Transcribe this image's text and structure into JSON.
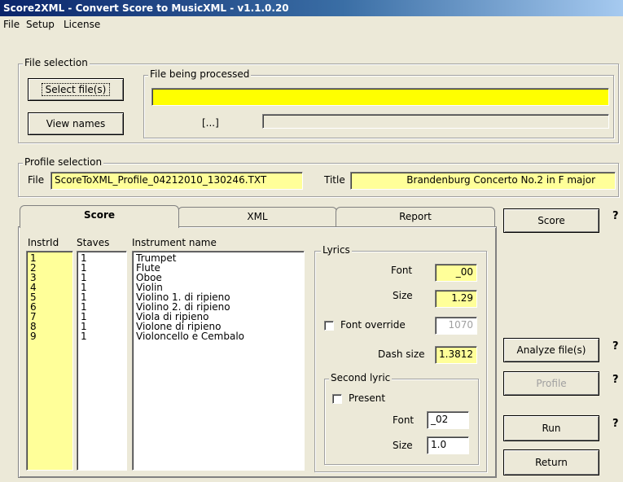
{
  "window": {
    "title": "Score2XML - Convert Score to MusicXML - v1.1.0.20"
  },
  "menu": {
    "file": "File",
    "setup": "Setup",
    "license": "License"
  },
  "file_selection": {
    "group_label": "File selection",
    "select_button": "Select file(s)",
    "view_button": "View names",
    "processing_label": "File being processed",
    "current_file": "",
    "ellipsis": "[...]",
    "path": ""
  },
  "profile_selection": {
    "group_label": "Profile selection",
    "file_label": "File",
    "file_value": "ScoreToXML_Profile_04212010_130246.TXT",
    "title_label": "Title",
    "title_value": "Brandenburg Concerto No.2 in F major"
  },
  "tabs": {
    "score": "Score",
    "xml": "XML",
    "report": "Report"
  },
  "score_tab": {
    "col_instrid": "InstrId",
    "col_staves": "Staves",
    "col_name": "Instrument name",
    "instr_ids": [
      "1",
      "2",
      "3",
      "4",
      "5",
      "6",
      "7",
      "8",
      "9"
    ],
    "staves": [
      "1",
      "1",
      "1",
      "1",
      "1",
      "1",
      "1",
      "1",
      "1"
    ],
    "instrument_names": [
      "Trumpet",
      "Flute",
      "Oboe",
      "Violin",
      "Violino 1. di ripieno",
      "Violino 2. di ripieno",
      "Viola di ripieno",
      "Violone di ripieno",
      "Violoncello e Cembalo"
    ]
  },
  "lyrics": {
    "group_label": "Lyrics",
    "font_label": "Font",
    "font_value": "_00",
    "size_label": "Size",
    "size_value": "1.29",
    "override_label": "Font override",
    "override_value": "1070",
    "dash_label": "Dash size",
    "dash_value": "1.3812",
    "second": {
      "group_label": "Second lyric",
      "present_label": "Present",
      "font_label": "Font",
      "font_value": "_02",
      "size_label": "Size",
      "size_value": "1.0"
    }
  },
  "actions": {
    "score": "Score",
    "analyze": "Analyze file(s)",
    "profile": "Profile",
    "run": "Run",
    "return": "Return",
    "help": "?"
  }
}
